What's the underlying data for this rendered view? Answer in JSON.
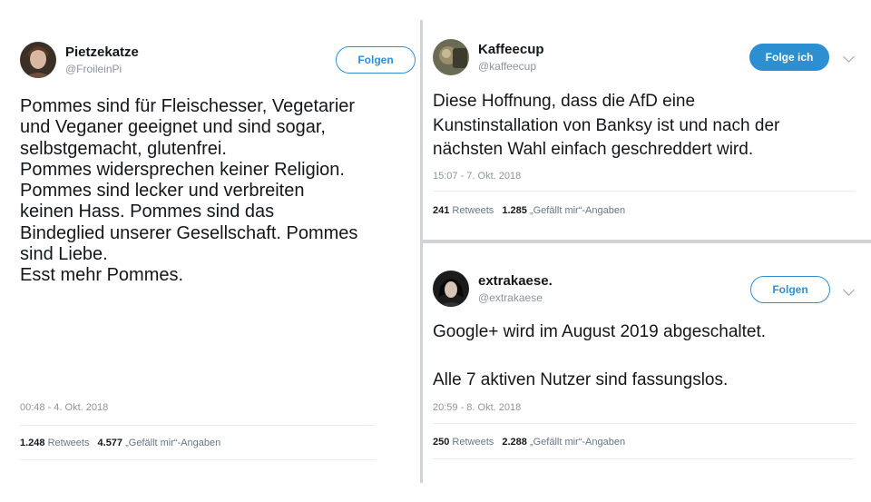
{
  "tweets": [
    {
      "name": "Pietzekatze",
      "handle": "@FroileinPi",
      "button": "Folgen",
      "text": "Pommes sind für Fleischesser, Vegetarier\nund Veganer geeignet und sind sogar,\nselbstgemacht, glutenfrei.\nPommes widersprechen keiner Religion.\nPommes sind lecker und verbreiten\nkeinen Hass. Pommes sind das\nBindeglied unserer Gesellschaft. Pommes\nsind Liebe.\nEsst mehr Pommes.",
      "timestamp": "00:48 - 4. Okt. 2018",
      "retweets": "1.248",
      "retweets_label": "Retweets",
      "likes": "4.577",
      "likes_label": "„Gefällt mir“-Angaben"
    },
    {
      "name": "Kaffeecup",
      "handle": "@kaffeecup",
      "button": "Folge ich",
      "text": "Diese Hoffnung, dass die AfD eine\nKunstinstallation von Banksy ist und nach der\nnächsten Wahl einfach geschreddert wird.",
      "timestamp": "15:07 - 7. Okt. 2018",
      "retweets": "241",
      "retweets_label": "Retweets",
      "likes": "1.285",
      "likes_label": "„Gefällt mir“-Angaben"
    },
    {
      "name": "extrakaese.",
      "handle": "@extrakaese",
      "button": "Folgen",
      "text": "Google+ wird im August 2019 abgeschaltet.\n\nAlle 7 aktiven Nutzer sind fassungslos.",
      "timestamp": "20:59 - 8. Okt. 2018",
      "retweets": "250",
      "retweets_label": "Retweets",
      "likes": "2.288",
      "likes_label": "„Gefällt mir“-Angaben"
    }
  ],
  "colors": {
    "accent": "#2b90d9",
    "muted": "#8b949c",
    "divider": "#cfd3d6"
  },
  "icons": [
    "avatar",
    "chevron-down-icon"
  ]
}
